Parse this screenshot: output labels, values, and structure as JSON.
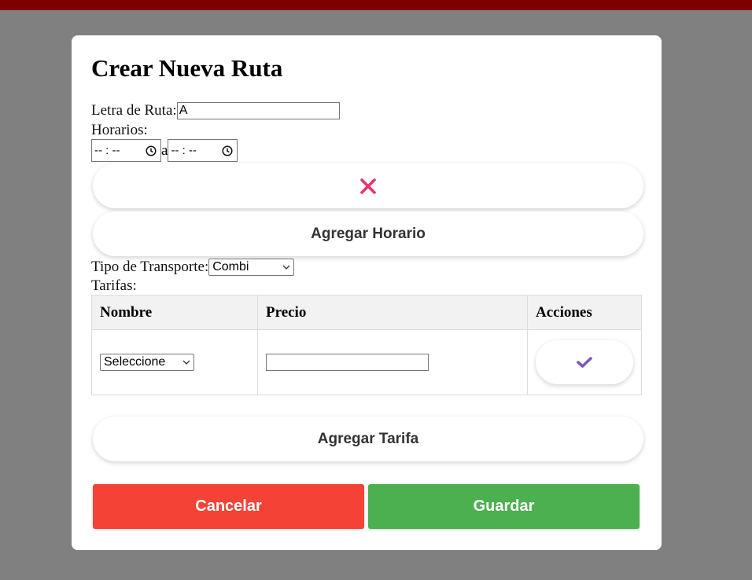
{
  "modal": {
    "title": "Crear Nueva Ruta",
    "letra_label": "Letra de Ruta:",
    "letra_value": "A",
    "horarios_label": "Horarios:",
    "time_start_placeholder": "-- : --",
    "time_separator": "a",
    "time_end_placeholder": "-- : --",
    "remove_icon": "close-icon",
    "add_horario_label": "Agregar Horario",
    "tipo_label": "Tipo de Transporte:",
    "tipo_selected": "Combi",
    "tarifas_label": "Tarifas:",
    "table": {
      "headers": [
        "Nombre",
        "Precio",
        "Acciones"
      ],
      "rows": [
        {
          "nombre_selected": "Seleccione",
          "precio_value": "",
          "action_icon": "check-icon"
        }
      ]
    },
    "add_tarifa_label": "Agregar Tarifa",
    "cancel_label": "Cancelar",
    "save_label": "Guardar"
  },
  "colors": {
    "topbar": "#7d0000",
    "overlay": "#808080",
    "remove_icon": "#e8336b",
    "check_icon": "#7e57c2",
    "cancel": "#f44336",
    "save": "#4caf50"
  }
}
